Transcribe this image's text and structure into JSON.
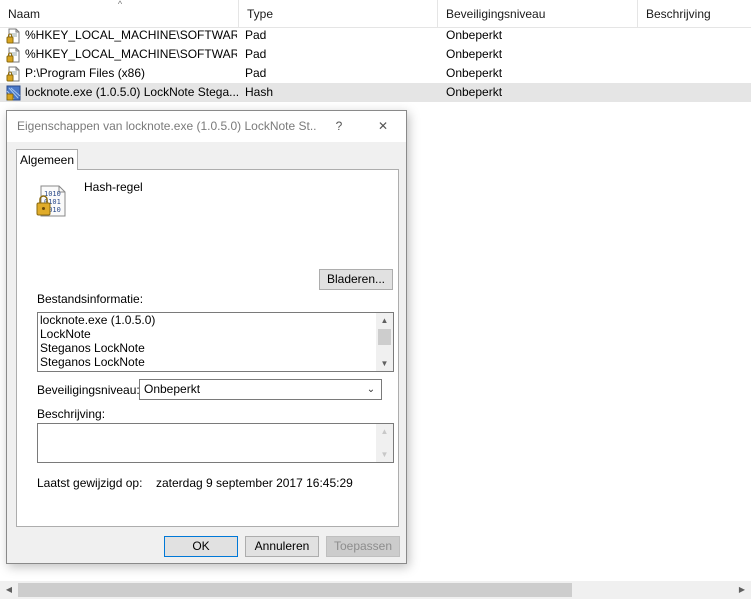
{
  "list": {
    "columns": [
      "Naam",
      "Type",
      "Beveiligingsniveau",
      "Beschrijving"
    ],
    "sort_indicator": "^",
    "rows": [
      {
        "name": "%HKEY_LOCAL_MACHINE\\SOFTWAR...",
        "type": "Pad",
        "level": "Onbeperkt",
        "icon": "path-rule-icon"
      },
      {
        "name": "%HKEY_LOCAL_MACHINE\\SOFTWAR...",
        "type": "Pad",
        "level": "Onbeperkt",
        "icon": "path-rule-icon"
      },
      {
        "name": "P:\\Program Files (x86)",
        "type": "Pad",
        "level": "Onbeperkt",
        "icon": "path-rule-icon"
      },
      {
        "name": "locknote.exe (1.0.5.0)  LockNote  Stega...",
        "type": "Hash",
        "level": "Onbeperkt",
        "icon": "hash-rule-icon",
        "selected": true
      }
    ]
  },
  "dialog": {
    "title": "Eigenschappen van locknote.exe (1.0.5.0)  LockNote  St...",
    "help_glyph": "?",
    "close_glyph": "✕",
    "tab_label": "Algemeen",
    "rule_type": "Hash-regel",
    "browse_label": "Bladeren...",
    "file_info_label": "Bestandsinformatie:",
    "file_info_lines": [
      "locknote.exe (1.0.5.0)",
      "LockNote",
      "Steganos LockNote",
      "Steganos LockNote"
    ],
    "security_level_label": "Beveiligingsniveau:",
    "security_level_value": "Onbeperkt",
    "description_label": "Beschrijving:",
    "description_value": "",
    "last_modified_label": "Laatst gewijzigd op:",
    "last_modified_value": "zaterdag 9 september 2017  16:45:29",
    "ok_label": "OK",
    "cancel_label": "Annuleren",
    "apply_label": "Toepassen"
  },
  "colors": {
    "selection": "#e5e5e5",
    "dialog_bg": "#f0f0f0",
    "button_bg": "#e1e1e1"
  }
}
